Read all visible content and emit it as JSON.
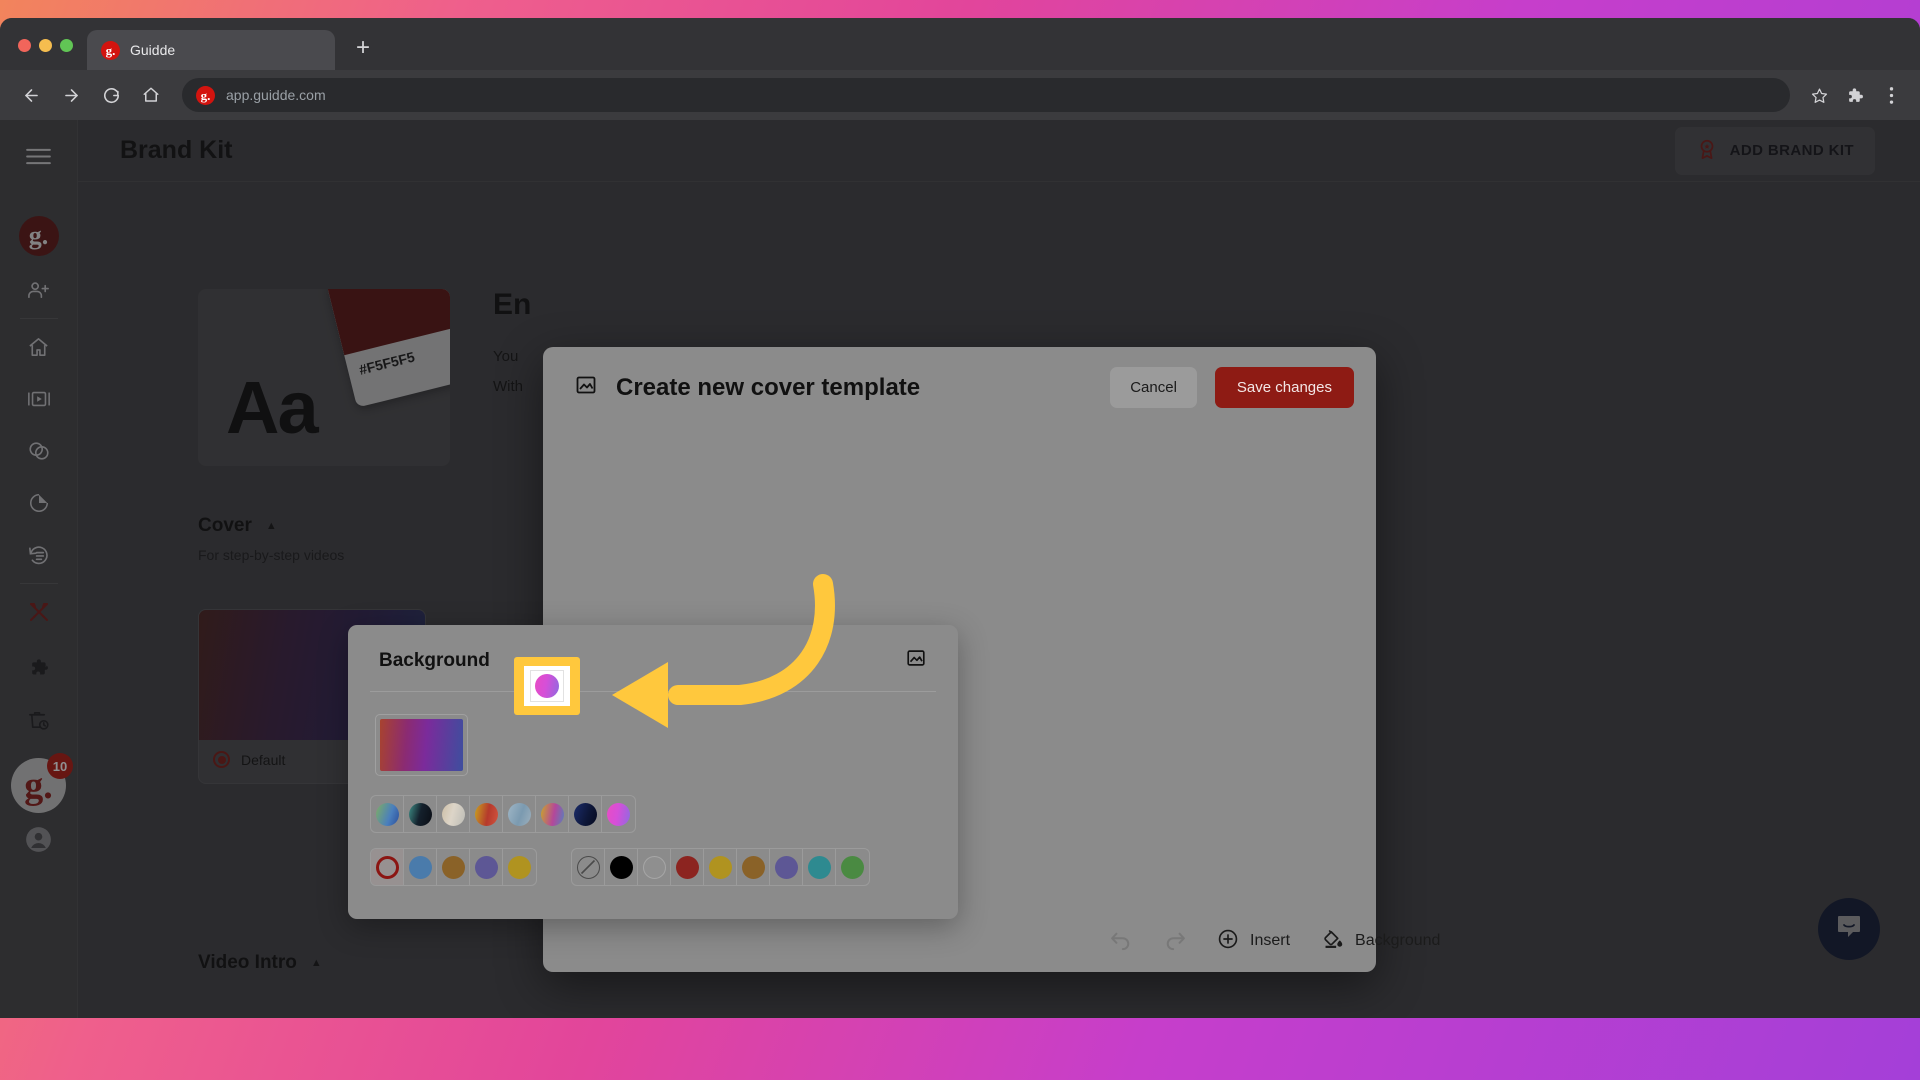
{
  "browser": {
    "tab_title": "Guidde",
    "tab_favicon": "g.",
    "new_tab_label": "+",
    "back_icon": "arrow-left-icon",
    "forward_icon": "arrow-right-icon",
    "reload_icon": "reload-icon",
    "home_icon": "home-icon",
    "url": "app.guidde.com",
    "url_favicon": "g.",
    "star_icon": "bookmark-star-icon",
    "extensions_icon": "puzzle-icon",
    "menu_icon": "kebab-menu-icon"
  },
  "sidebar": {
    "hamburger": "menu-icon",
    "logo": "g.",
    "badge_count": "10",
    "items": [
      {
        "name": "invite-user",
        "icon": "user-plus-icon"
      },
      {
        "name": "home",
        "icon": "home-icon"
      },
      {
        "name": "videos",
        "icon": "video-library-icon"
      },
      {
        "name": "spaces",
        "icon": "overlapping-circles-icon"
      },
      {
        "name": "insights",
        "icon": "pie-chart-icon"
      },
      {
        "name": "history",
        "icon": "history-icon"
      },
      {
        "name": "brand-kit",
        "icon": "pencil-ruler-icon"
      },
      {
        "name": "extensions",
        "icon": "puzzle-piece-icon"
      },
      {
        "name": "trash",
        "icon": "trash-clock-icon"
      },
      {
        "name": "account",
        "icon": "avatar-icon"
      }
    ]
  },
  "header": {
    "title": "Brand Kit",
    "add_button_label": "ADD BRAND KIT",
    "add_button_icon": "award-badge-icon"
  },
  "main": {
    "font_card": {
      "sample": "Aa",
      "hex": "#F5F5F5"
    },
    "entity": {
      "title": "En",
      "body_line1": "You",
      "body_line2": "With"
    },
    "cover": {
      "title": "Cover",
      "caret": "▲",
      "subtitle": "For step-by-step videos",
      "option_label": "Default"
    },
    "video_intro": {
      "title": "Video Intro",
      "caret": "▲"
    },
    "chat_icon": "intercom-chat-icon"
  },
  "modal": {
    "title": "Create new cover template",
    "title_icon": "image-icon",
    "cancel_label": "Cancel",
    "save_label": "Save changes",
    "toolbar": {
      "undo_icon": "undo-icon",
      "redo_icon": "redo-icon",
      "insert_label": "Insert",
      "insert_icon": "plus-circle-icon",
      "background_label": "Background",
      "background_icon": "paint-bucket-icon"
    }
  },
  "background_popover": {
    "title": "Background",
    "image_icon": "image-icon",
    "preview_gradient": "linear-gradient(95deg,#a8432f,#8b2b72,#7b2b9b,#3e4e9e)",
    "gradients": [
      {
        "name": "green-blue",
        "css": "linear-gradient(110deg,#7fae63 0%,#4a7fbd 60%,#2b4f9c 100%)"
      },
      {
        "name": "teal-black",
        "css": "linear-gradient(105deg,#3f8f87 0%,#14202c 48%,#0a0d14 100%)"
      },
      {
        "name": "beige-grey",
        "css": "linear-gradient(105deg,#cdbfa7 0%,#ddd5c8 45%,#bcbcb6 100%)"
      },
      {
        "name": "gold-red",
        "css": "linear-gradient(100deg,#c8a21f 0%,#b53a2c 55%,#d2543f 100%)"
      },
      {
        "name": "steel-blue",
        "css": "linear-gradient(110deg,#9fb6c6 0%,#7b9ab0 55%,#9db0bd 100%)"
      },
      {
        "name": "gold-magenta",
        "css": "linear-gradient(100deg,#c9a52a 0%,#b4479a 55%,#5a7fbc 100%)"
      },
      {
        "name": "navy",
        "css": "linear-gradient(110deg,#1b2c6b 0%,#0d1637 60%,#060a20 100%)"
      },
      {
        "name": "pink-purple-selected",
        "css": "linear-gradient(100deg,#e84dc4 0%,#d64fd8 45%,#8f6ae0 100%)"
      }
    ],
    "selected_gradient_index": 7,
    "brand_colors": [
      {
        "name": "custom-selected",
        "hex": "#8b1512",
        "style": "ring"
      },
      {
        "name": "brand-blue",
        "hex": "#4a7bab"
      },
      {
        "name": "brand-brown",
        "hex": "#8a6228"
      },
      {
        "name": "brand-purple",
        "hex": "#5d5795"
      },
      {
        "name": "brand-gold",
        "hex": "#b09320"
      }
    ],
    "palette_colors": [
      {
        "name": "none",
        "hex": "transparent",
        "style": "no-color"
      },
      {
        "name": "black",
        "hex": "#000000"
      },
      {
        "name": "white",
        "hex": "#8f8f8f",
        "style": "outline"
      },
      {
        "name": "dark-red",
        "hex": "#8c2420"
      },
      {
        "name": "gold",
        "hex": "#b09320"
      },
      {
        "name": "brown",
        "hex": "#8a6228"
      },
      {
        "name": "purple",
        "hex": "#5d5795"
      },
      {
        "name": "teal",
        "hex": "#2e8a90"
      },
      {
        "name": "green",
        "hex": "#4a8a42"
      }
    ]
  },
  "annotation": {
    "highlight_color": "#ffc83d",
    "arrow_color": "#ffc83d"
  }
}
